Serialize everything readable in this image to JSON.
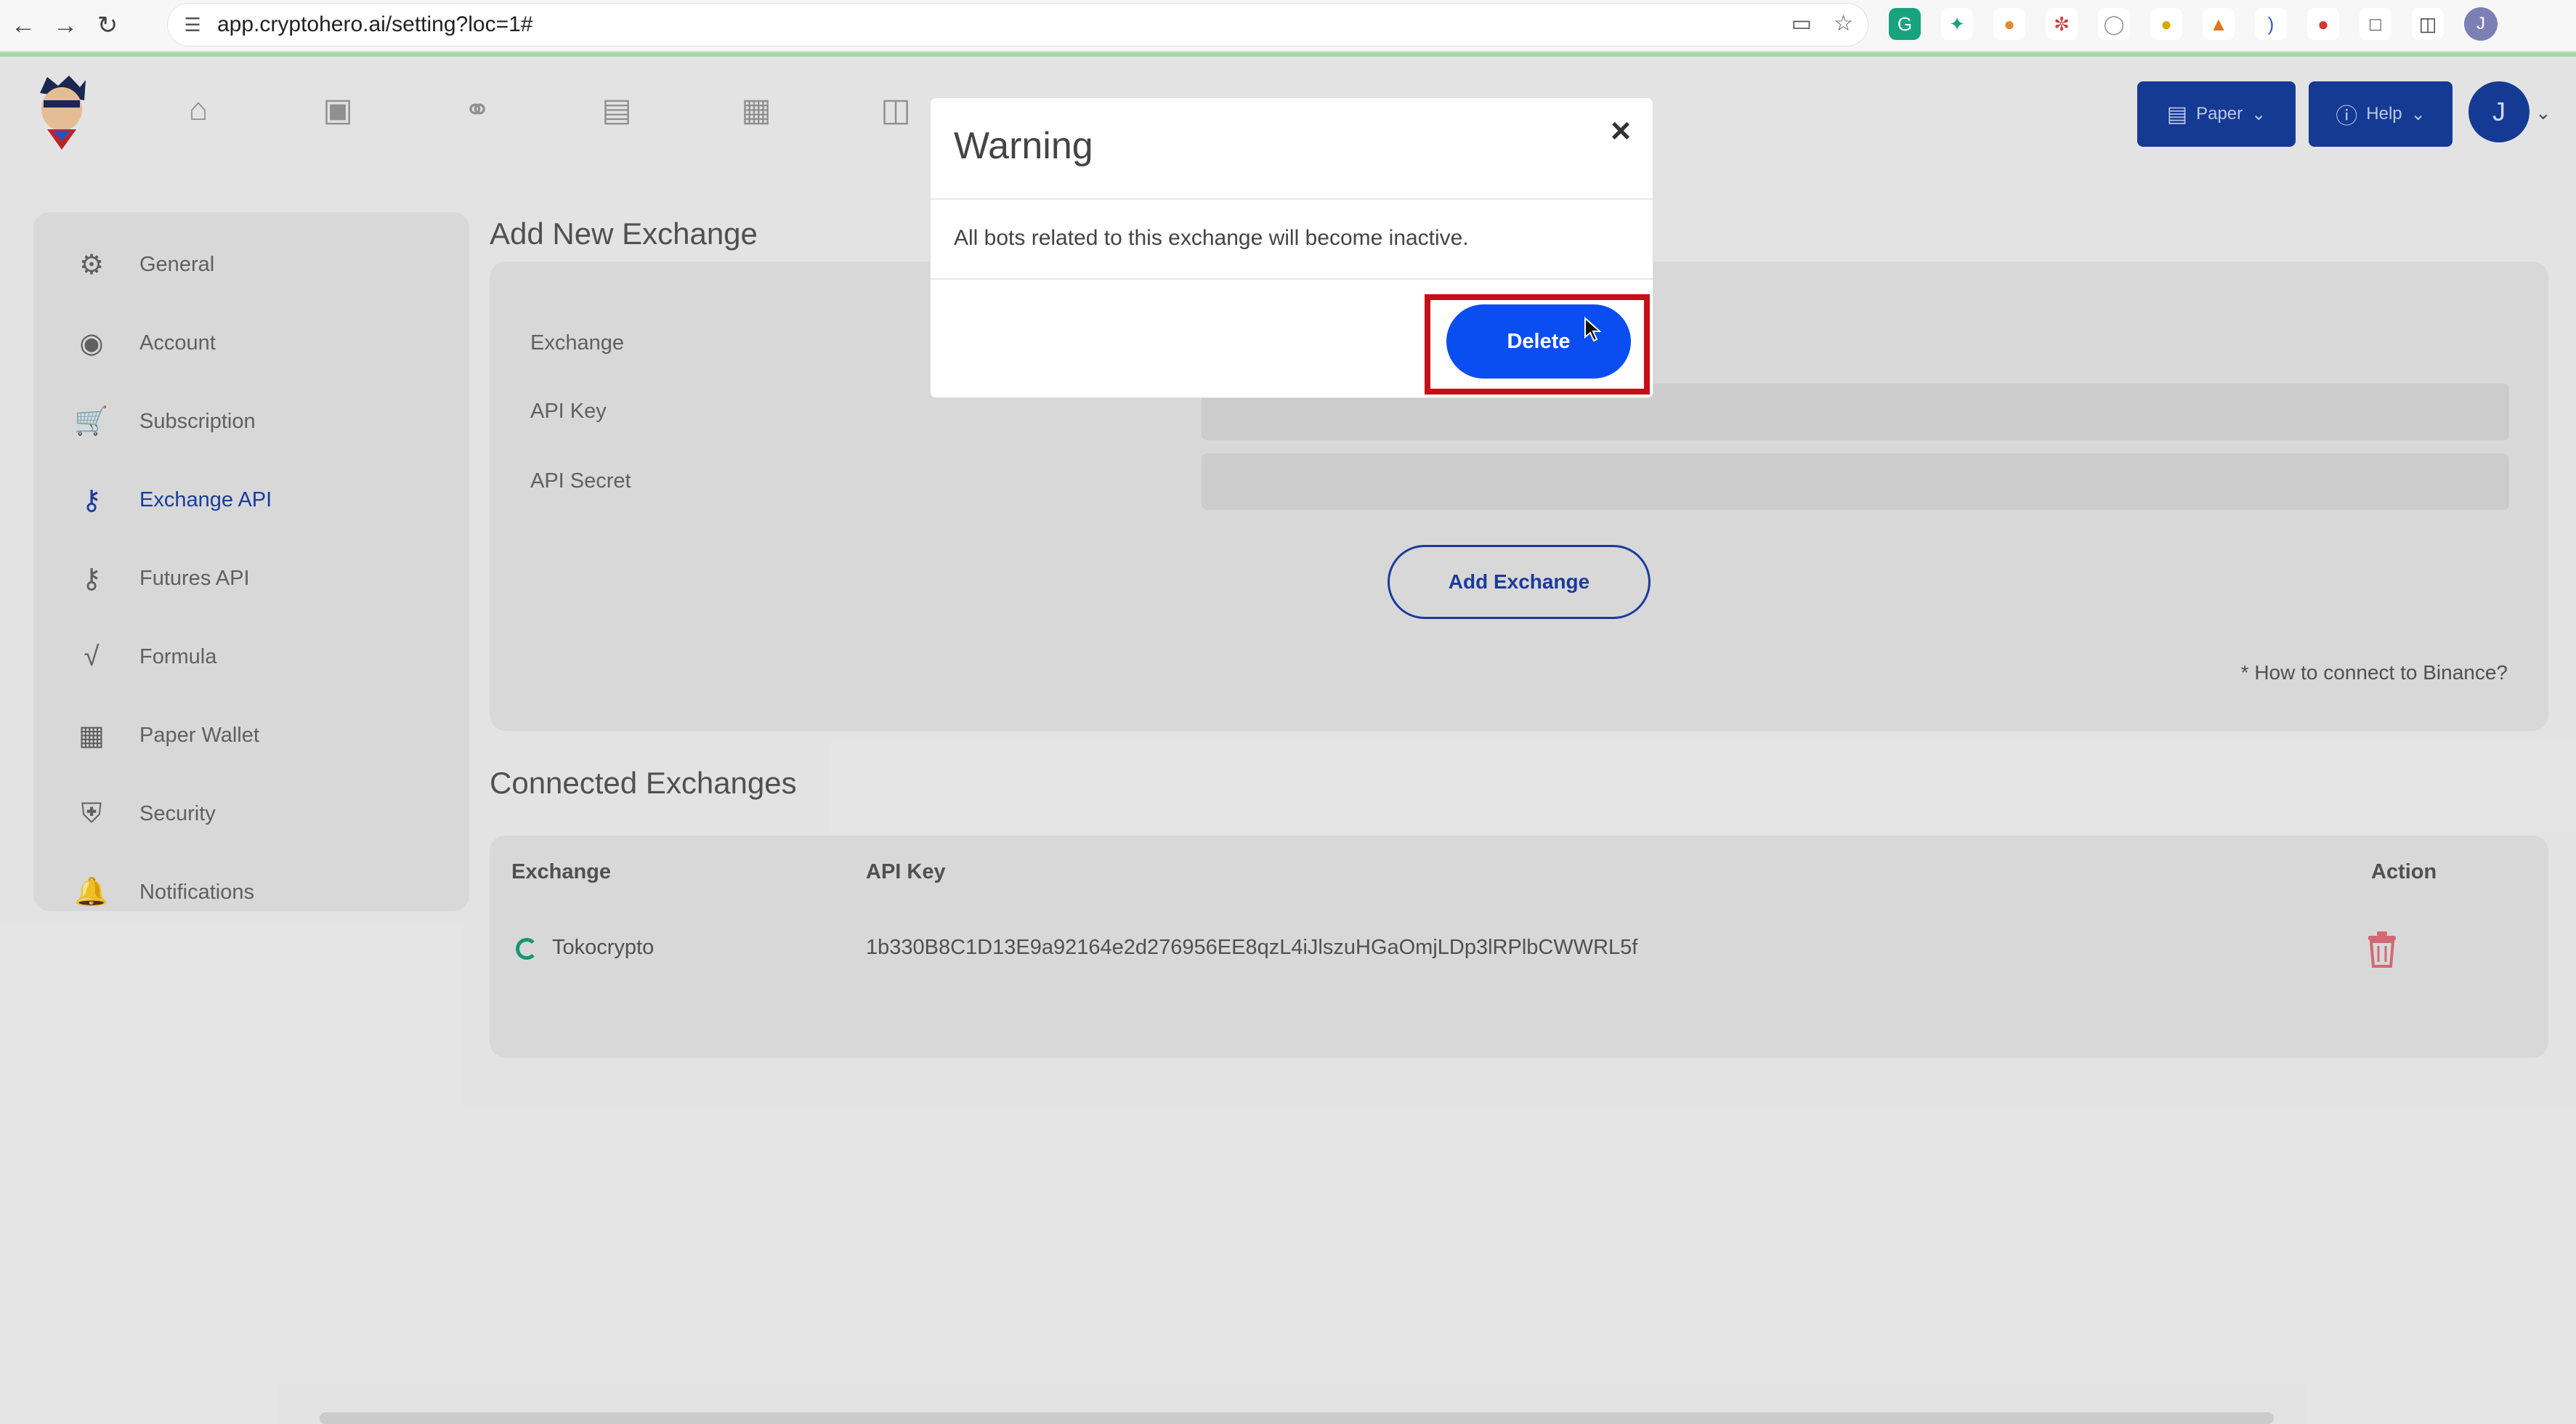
{
  "browser": {
    "url": "app.cryptohero.ai/setting?loc=1#",
    "profile_initial": "J"
  },
  "header": {
    "nav_icons": [
      "home-icon",
      "robot-icon",
      "handshake-icon",
      "briefcase-icon",
      "marketplace-icon",
      "terminal-icon",
      "chart-icon"
    ],
    "paper_label": "Paper",
    "help_label": "Help",
    "user_initial": "J"
  },
  "sidebar": {
    "items": [
      {
        "label": "General",
        "icon": "gear-icon"
      },
      {
        "label": "Account",
        "icon": "user-circle-icon"
      },
      {
        "label": "Subscription",
        "icon": "cart-icon"
      },
      {
        "label": "Exchange API",
        "icon": "key-icon",
        "active": true
      },
      {
        "label": "Futures API",
        "icon": "key-icon"
      },
      {
        "label": "Formula",
        "icon": "square-root-icon"
      },
      {
        "label": "Paper Wallet",
        "icon": "wallet-icon"
      },
      {
        "label": "Security",
        "icon": "shield-icon"
      },
      {
        "label": "Notifications",
        "icon": "bell-icon"
      }
    ]
  },
  "add_exchange": {
    "title": "Add New Exchange",
    "exchange_label": "Exchange",
    "api_key_label": "API Key",
    "api_secret_label": "API Secret",
    "api_key_value": "",
    "api_secret_value": "",
    "add_button": "Add Exchange",
    "help_link": "* How to connect to Binance?"
  },
  "connected": {
    "title": "Connected Exchanges",
    "columns": [
      "Exchange",
      "API Key",
      "Action"
    ],
    "rows": [
      {
        "exchange": "Tokocrypto",
        "api_key": "1b330B8C1D13E9a92164e2d276956EE8qzL4iJlszuHGaOmjLDp3lRPlbCWWRL5f"
      }
    ]
  },
  "modal": {
    "title": "Warning",
    "close": "×",
    "message": "All bots related to this exchange will become inactive.",
    "delete_button": "Delete"
  },
  "colors": {
    "primary": "#1c3fa5",
    "delete_blue": "#0a4ef2",
    "highlight_red": "#c80e16",
    "trash_red": "#e0707a"
  }
}
